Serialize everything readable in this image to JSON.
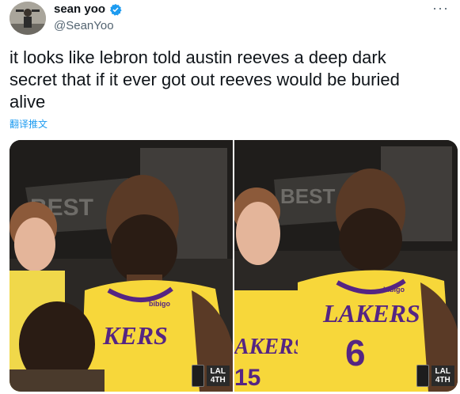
{
  "tweet": {
    "display_name": "sean yoo",
    "handle": "@SeanYoo",
    "text": "it looks like lebron told austin reeves a deep dark secret that if it ever got out reeves would be buried alive",
    "translate_label": "翻译推文",
    "more_icon": "more-icon"
  },
  "media": {
    "panels": [
      {
        "jersey_text": "KERS",
        "score_team": "LAL",
        "score_period": "4TH"
      },
      {
        "jersey_text": "LAKERS",
        "jersey_number": "6",
        "left_jersey_text": "AKERS",
        "left_jersey_number": "15",
        "score_team": "LAL",
        "score_period": "4TH"
      }
    ],
    "sponsor": "bibigo",
    "banner_text": "BEST"
  },
  "colors": {
    "verified": "#1d9bf0",
    "link": "#1d9bf0",
    "lakers_gold": "#f7d73a",
    "lakers_purple": "#552583"
  }
}
